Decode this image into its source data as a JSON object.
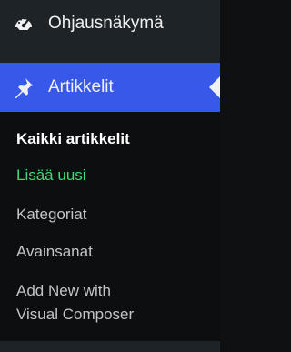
{
  "colors": {
    "sidebar_bg": "#1d2327",
    "submenu_bg": "#0d0e10",
    "active_bg": "#3858e9",
    "text": "#f0f0f1",
    "submenu_text": "#c3c4c7",
    "highlight_text": "#3edc72"
  },
  "menu": {
    "dashboard": {
      "label": "Ohjausnäkymä",
      "icon": "dashboard-gauge-icon"
    },
    "articles": {
      "label": "Artikkelit",
      "icon": "pushpin-icon"
    }
  },
  "submenu": [
    {
      "label": "Kaikki artikkelit",
      "state": "current"
    },
    {
      "label": "Lisää uusi",
      "state": "highlight"
    },
    {
      "label": "Kategoriat",
      "state": "normal"
    },
    {
      "label": "Avainsanat",
      "state": "normal"
    },
    {
      "label": "Add New with\nVisual Composer",
      "state": "normal"
    }
  ]
}
